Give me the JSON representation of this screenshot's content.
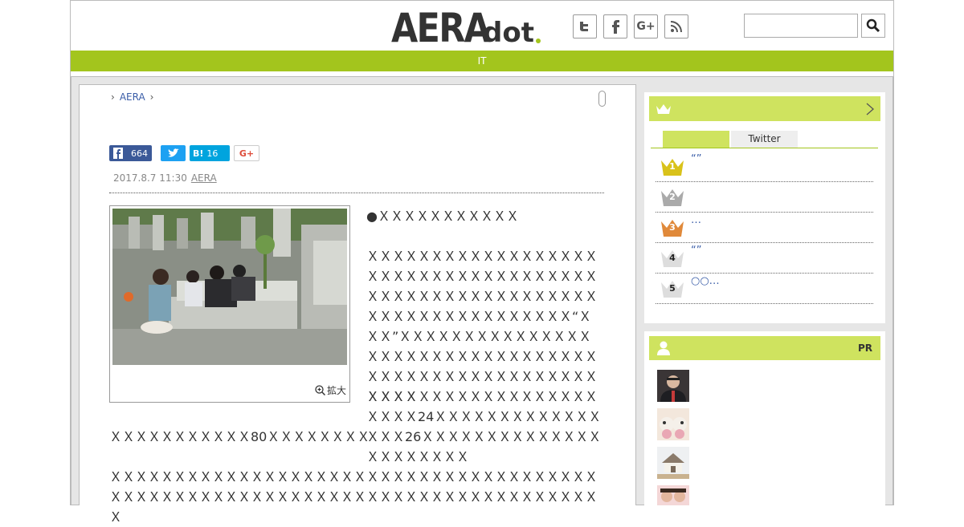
{
  "header": {
    "logo_main": "AERA",
    "logo_sub": "dot",
    "nav_label": "IT",
    "social": [
      "twitter-icon",
      "facebook-icon",
      "google-plus-icon",
      "rss-icon"
    ],
    "search": {
      "value": "",
      "placeholder": ""
    }
  },
  "breadcrumb": {
    "item": "AERA"
  },
  "share": {
    "facebook_count": "664",
    "hatena_label": "B!",
    "hatena_count": "16",
    "gplus_label": "G+"
  },
  "article": {
    "date": "2017.8.7 11:30",
    "source": "AERA",
    "zoom_label": "拡大",
    "heading": "●ＸＸＸＸＸＸＸＸＸＸＸ",
    "p1": "ＸＸＸＸＸＸＸＸＸＸＸＸＸＸＸＸＸＸＸＸＸＸＸＸＸＸＸＸＸＸＸＸＸＸＸＸＸＸＸＸＸＸＸＸＸＸＸＸＸＸＸＸＸＸＸＸＸＸＸＸＸＸＸＸＸＸＸＸＸＸ“ＸＸＸ”ＸＸＸＸＸＸＸＸＸＸＸＸＸＸＸＸＸＸＸＸＸＸＸＸＸＸＸＸＸＸＸＸＸＸＸＸＸＸＸＸＸＸＸＸＸＸＸＸＸＸＸＸＸＸＸ",
    "p2a": "ＸＸＸＸＸＸＸＸＸＸＸＸＸＸＸＸＸＸＸＸＸＸ24ＸＸＸＸＸＸＸＸＸＸＸＸＸＸＸＸ26ＸＸＸＸＸＸＸＸＸＸＸＸＸＸＸＸＸＸＸＸＸＸ",
    "p2b": "ＸＸＸＸＸＸＸＸＸＸＸ80ＸＸＸＸＸＸＸＸ",
    "p3": "ＸＸＸＸＸＸＸＸＸＸＸＸＸＸＸＸＸＸＸＸＸＸＸＸＸＸＸＸＸＸＸＸＸＸＸＸＸＸＸＸＸＸＸＸＸＸＸＸＸＸＸＸＸＸＸＸＸＸＸＸＸＸＸＸＸＸＸＸＸＸＸＸＸＸＸＸＸ"
  },
  "ranking": {
    "tabs": [
      "",
      "Twitter"
    ],
    "items": [
      {
        "rank": "1",
        "text": "“”",
        "color": "#d9c21a"
      },
      {
        "rank": "2",
        "text": "",
        "color": "#aaaaaa"
      },
      {
        "rank": "3",
        "text": "…",
        "color": "#e0893a"
      },
      {
        "rank": "4",
        "text": "“”",
        "color": "#dddddd"
      },
      {
        "rank": "5",
        "text": "○○…",
        "color": "#dddddd"
      }
    ]
  },
  "pr": {
    "label": "PR"
  },
  "colors": {
    "accent": "#a3c51d",
    "accent_light": "#cfe35f",
    "link": "#3b5ea8"
  }
}
